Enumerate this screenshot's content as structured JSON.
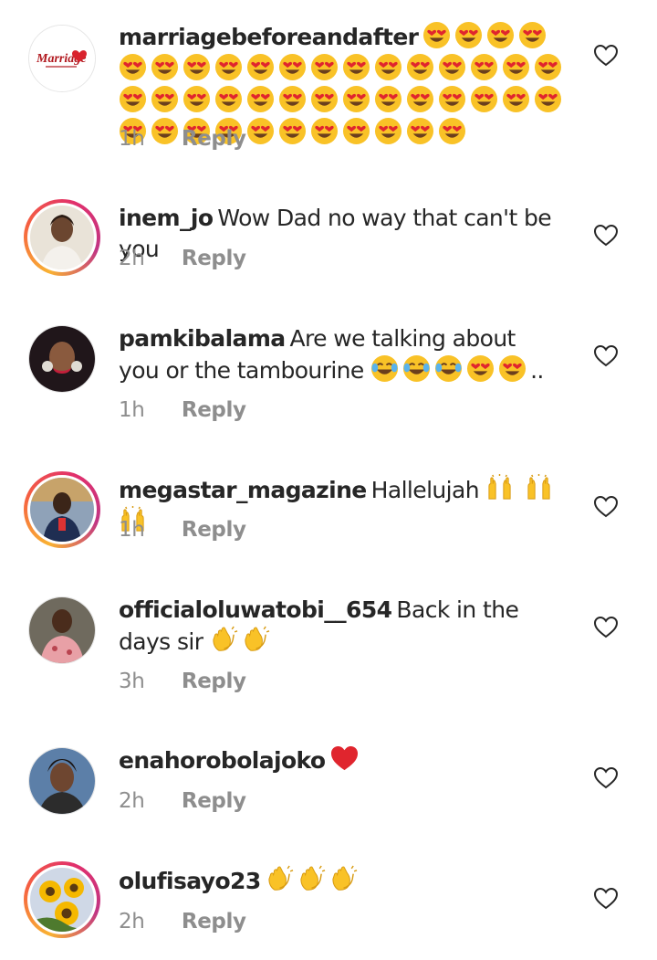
{
  "comments": [
    {
      "username": "marriagebeforeandafter",
      "text": "",
      "emoji_line": "😍😍😍😍😍😍😍😍😍😍😍😍😍😍😍😍😍😍😍😍😍😍😍😍😍😍😍😍😍😍😍😍😍😍😍😍😍😍😍😍😍😍😍",
      "time": "1h",
      "reply": "Reply",
      "avatar_logo_text": "Marriage",
      "avatar_type": "logo"
    },
    {
      "username": "inem_jo",
      "text": "Wow Dad no way that can't be you",
      "time": "2h",
      "reply": "Reply",
      "avatar_type": "story"
    },
    {
      "username": "pamkibalama",
      "text": "Are we talking about you or the tambourine",
      "emojis": "😂😂😂😍😍",
      "trailing": "..",
      "time": "1h",
      "reply": "Reply",
      "avatar_type": "plain"
    },
    {
      "username": "megastar_magazine",
      "text": "Hallelujah",
      "emojis": "🙌 🙌 🙌",
      "time": "1h",
      "reply": "Reply",
      "avatar_type": "story"
    },
    {
      "username": "officialoluwatobi__654",
      "text": "Back in the days sir",
      "emojis": "👏👏",
      "time": "3h",
      "reply": "Reply",
      "avatar_type": "plain"
    },
    {
      "username": "enahorobolajoko",
      "text": "",
      "emojis": "❤️",
      "time": "2h",
      "reply": "Reply",
      "avatar_type": "plain"
    },
    {
      "username": "olufisayo23",
      "text": "",
      "emojis": "👏👏👏",
      "time": "2h",
      "reply": "Reply",
      "avatar_type": "story"
    }
  ],
  "colors": {
    "text": "#262626",
    "secondary": "#8e8e8e",
    "story_ring_start": "#f9b233",
    "story_ring_end": "#c13584",
    "heart_emoji": "#e0252e",
    "emoji_yellow": "#f9c227"
  },
  "icons": {
    "like": "heart-outline-icon"
  }
}
